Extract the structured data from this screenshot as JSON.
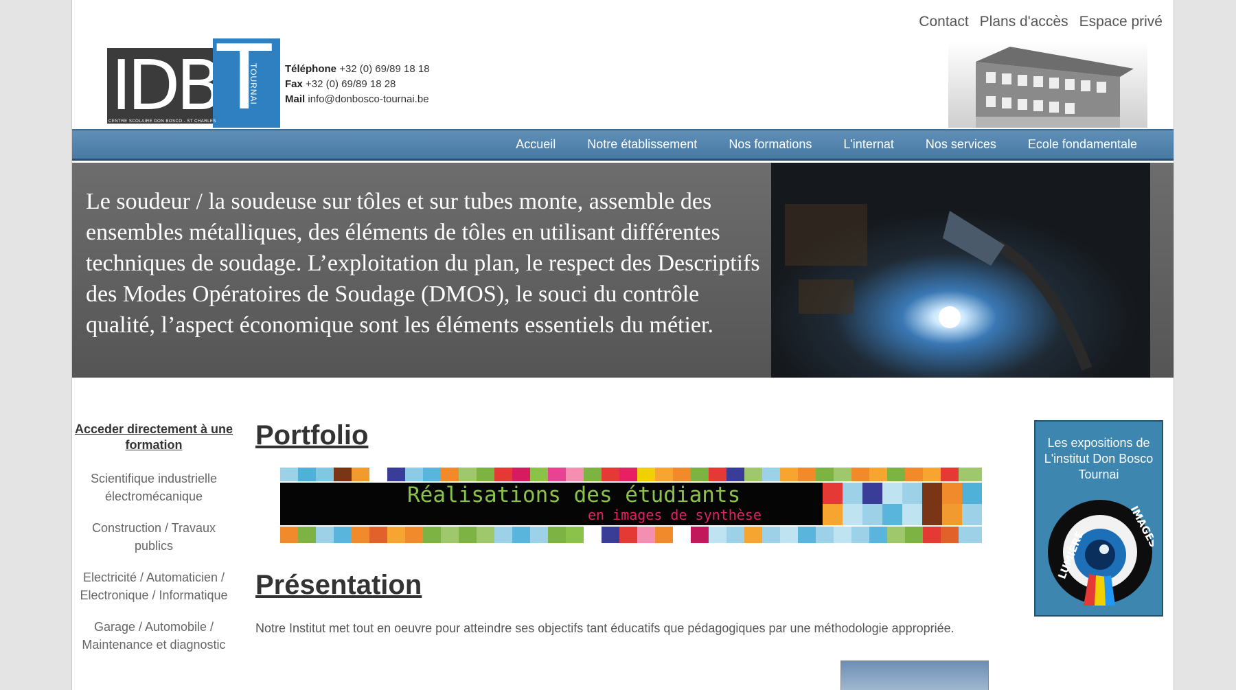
{
  "top_links": [
    "Contact",
    "Plans d'accès",
    "Espace privé"
  ],
  "logo": {
    "letters": "IDB",
    "big_letter": "T",
    "city": "TOURNAI",
    "caption": "CENTRE SCOLAIRE DON BOSCO - ST CHARLES"
  },
  "contact": {
    "phone_label": "Téléphone",
    "phone": "+32 (0) 69/89 18 18",
    "fax_label": "Fax",
    "fax": "+32 (0) 69/89 18 28",
    "mail_label": "Mail",
    "mail": "info@donbosco-tournai.be"
  },
  "nav": [
    "Accueil",
    "Notre établissement",
    "Nos formations",
    "L'internat",
    "Nos services",
    "Ecole fondamentale"
  ],
  "banner": {
    "text": "Le soudeur / la soudeuse sur tôles et sur tubes monte, assemble des ensembles métalliques, des éléments de tôles en utilisant différentes techniques de soudage. L’exploitation du plan, le respect des Descriptifs des Modes Opératoires de Soudage   (DMOS), le souci du contrôle qualité, l’aspect économique sont les éléments essentiels du métier."
  },
  "sidebar": {
    "title": "Acceder directement à une formation",
    "items": [
      "Scientifique industrielle électromécanique",
      "Construction / Travaux publics",
      "Electricité / Automaticien / Electronique / Informatique",
      "Garage / Automobile / Maintenance et diagnostic"
    ]
  },
  "main": {
    "portfolio_title": "Portfolio",
    "portfolio_banner_line1": "Réalisations des étudiants",
    "portfolio_banner_line2": "en images de synthèse",
    "presentation_title": "Présentation",
    "presentation_text": "Notre Institut met tout en oeuvre pour atteindre ses objectifs tant éducatifs que pédagogiques par une méthodologie appropriée."
  },
  "expo": {
    "text": "Les expositions de L'institut Don Bosco Tournai",
    "logo_left": "LUMIÈRE",
    "logo_right": "IMAGES"
  },
  "colors": {
    "nav": "#4f81ab",
    "accent_blue": "#3d86b0",
    "banner_gray": "#666666"
  }
}
